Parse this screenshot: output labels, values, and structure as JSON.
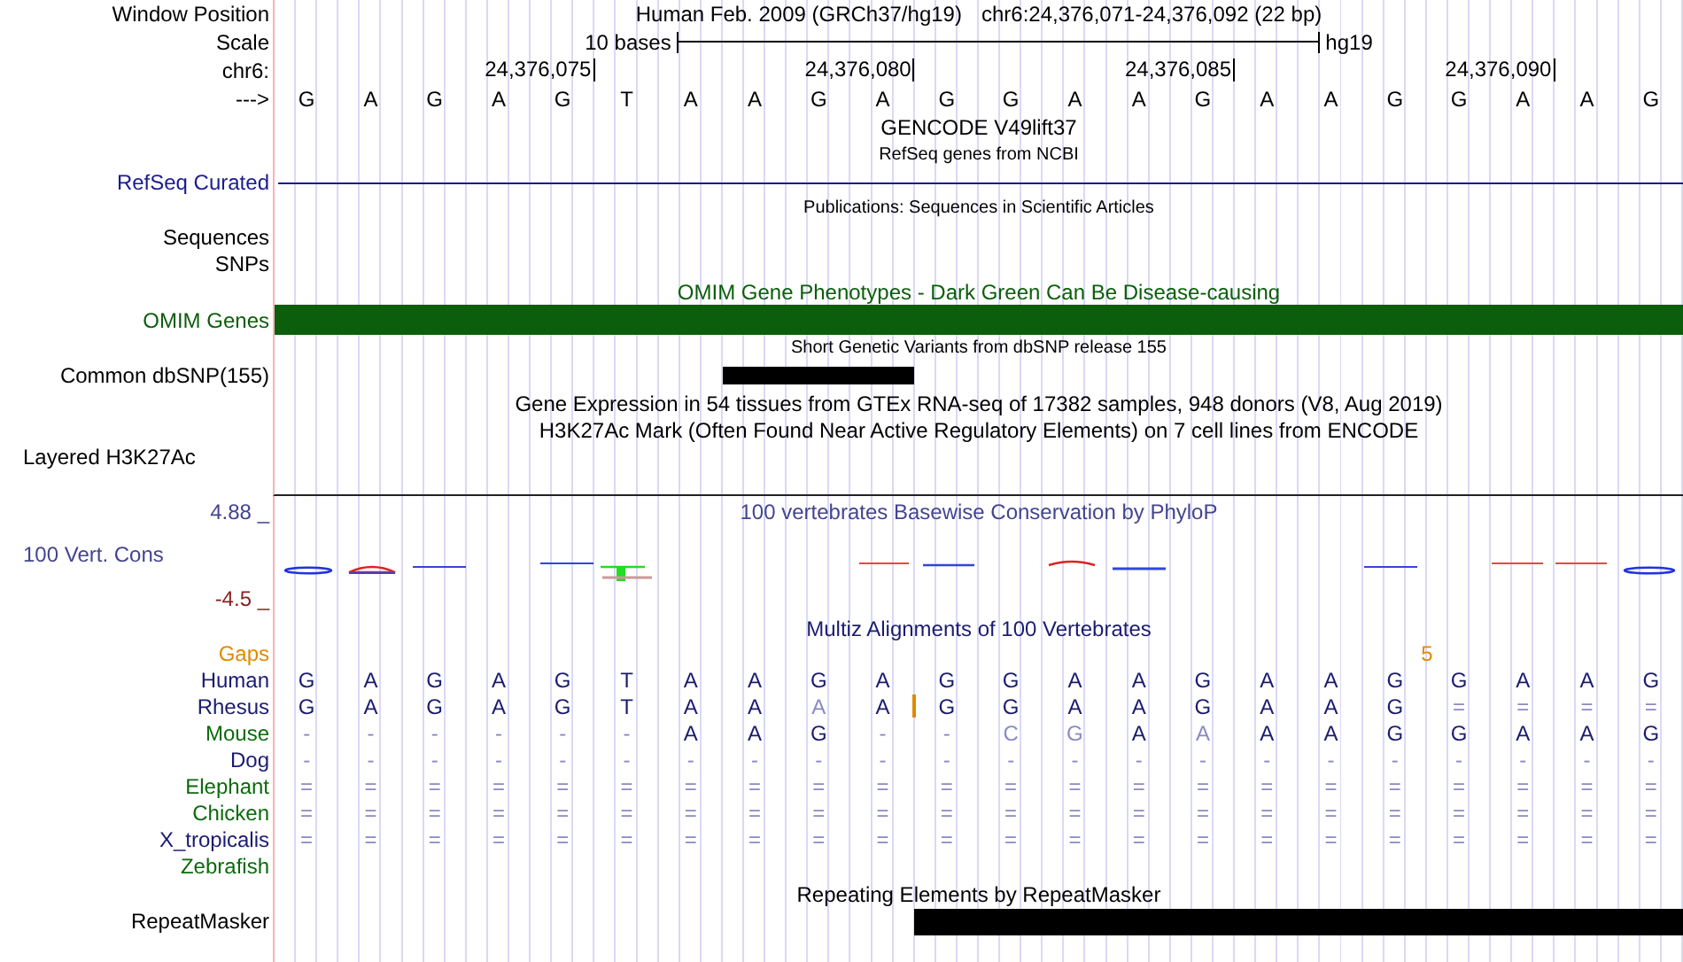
{
  "header": {
    "label": "Window Position",
    "title": "Human Feb. 2009 (GRCh37/hg19)",
    "position": "chr6:24,376,071-24,376,092 (22 bp)"
  },
  "scale": {
    "label": "Scale",
    "left_text": "10 bases",
    "right_text": "hg19"
  },
  "ruler": {
    "label": "chr6:",
    "ticks": [
      "24,376,075",
      "24,376,080",
      "24,376,085",
      "24,376,090"
    ]
  },
  "sequence": {
    "label": "--->",
    "bases": [
      "G",
      "A",
      "G",
      "A",
      "G",
      "T",
      "A",
      "A",
      "G",
      "A",
      "G",
      "G",
      "A",
      "A",
      "G",
      "A",
      "A",
      "G",
      "G",
      "A",
      "A",
      "G"
    ]
  },
  "tracks": [
    {
      "kind": "title",
      "title": "GENCODE V49lift37",
      "color": "#000000"
    },
    {
      "kind": "note",
      "title": "RefSeq genes from NCBI"
    },
    {
      "kind": "line",
      "label": "RefSeq Curated",
      "color": "#1b1b8f"
    },
    {
      "kind": "note",
      "title": "Publications: Sequences in Scientific Articles"
    },
    {
      "kind": "label",
      "label": "Sequences",
      "color": "#000000"
    },
    {
      "kind": "label",
      "label": "SNPs",
      "color": "#000000"
    },
    {
      "kind": "title",
      "title": "OMIM Gene Phenotypes - Dark Green Can Be Disease-causing",
      "color": "#0b5e0b"
    },
    {
      "kind": "bar",
      "label": "OMIM Genes",
      "color": "#0b5e0b"
    },
    {
      "kind": "note",
      "title": "Short Genetic Variants from dbSNP release 155"
    },
    {
      "kind": "bar",
      "label": "Common dbSNP(155)",
      "color": "#000000"
    },
    {
      "kind": "title",
      "title": "Gene Expression in 54 tissues from GTEx RNA-seq of 17382 samples, 948 donors (V8, Aug 2019)",
      "color": "#000000"
    },
    {
      "kind": "title",
      "title": "H3K27Ac Mark (Often Found Near Active Regulatory Elements) on 7 cell lines from ENCODE",
      "color": "#000000"
    },
    {
      "kind": "composite",
      "label": "Layered H3K27Ac",
      "color": "#000000"
    },
    {
      "kind": "rule"
    }
  ],
  "conservation": {
    "max": "4.88 _",
    "title": "100 vertebrates Basewise Conservation by PhyloP",
    "label": "100 Vert. Cons",
    "min": "-4.5 _"
  },
  "multiz": {
    "title": "Multiz Alignments of 100 Vertebrates",
    "gaps": {
      "label": "Gaps",
      "marks": [
        {
          "text": "5"
        }
      ]
    },
    "species": [
      {
        "name": "Human",
        "color": "#1b1b70",
        "bases": [
          {
            "b": "G",
            "faded": false
          },
          {
            "b": "A",
            "faded": false
          },
          {
            "b": "G",
            "faded": false
          },
          {
            "b": "A",
            "faded": false
          },
          {
            "b": "G",
            "faded": false
          },
          {
            "b": "T",
            "faded": false
          },
          {
            "b": "A",
            "faded": false
          },
          {
            "b": "A",
            "faded": false
          },
          {
            "b": "G",
            "faded": false
          },
          {
            "b": "A",
            "faded": false
          },
          {
            "b": "G",
            "faded": false
          },
          {
            "b": "G",
            "faded": false
          },
          {
            "b": "A",
            "faded": false
          },
          {
            "b": "A",
            "faded": false
          },
          {
            "b": "G",
            "faded": false
          },
          {
            "b": "A",
            "faded": false
          },
          {
            "b": "A",
            "faded": false
          },
          {
            "b": "G",
            "faded": false
          },
          {
            "b": "G",
            "faded": false
          },
          {
            "b": "A",
            "faded": false
          },
          {
            "b": "A",
            "faded": false
          },
          {
            "b": "G",
            "faded": false
          }
        ]
      },
      {
        "name": "Rhesus",
        "color": "#1b1b70",
        "bases": [
          {
            "b": "G",
            "faded": false
          },
          {
            "b": "A",
            "faded": false
          },
          {
            "b": "G",
            "faded": false
          },
          {
            "b": "A",
            "faded": false
          },
          {
            "b": "G",
            "faded": false
          },
          {
            "b": "T",
            "faded": false
          },
          {
            "b": "A",
            "faded": false
          },
          {
            "b": "A",
            "faded": false
          },
          {
            "b": "A",
            "faded": true
          },
          {
            "b": "A",
            "faded": false
          },
          {
            "b": "G",
            "faded": false
          },
          {
            "b": "G",
            "faded": false
          },
          {
            "b": "A",
            "faded": false
          },
          {
            "b": "A",
            "faded": false
          },
          {
            "b": "G",
            "faded": false
          },
          {
            "b": "A",
            "faded": false
          },
          {
            "b": "A",
            "faded": false
          },
          {
            "b": "G",
            "faded": false
          },
          {
            "b": "=",
            "faded": true
          },
          {
            "b": "=",
            "faded": true
          },
          {
            "b": "=",
            "faded": true
          },
          {
            "b": "=",
            "faded": true
          }
        ]
      },
      {
        "name": "Mouse",
        "color": "#0b6b0b",
        "bases": [
          {
            "b": "-",
            "faded": true
          },
          {
            "b": "-",
            "faded": true
          },
          {
            "b": "-",
            "faded": true
          },
          {
            "b": "-",
            "faded": true
          },
          {
            "b": "-",
            "faded": true
          },
          {
            "b": "-",
            "faded": true
          },
          {
            "b": "A",
            "faded": false
          },
          {
            "b": "A",
            "faded": false
          },
          {
            "b": "G",
            "faded": false
          },
          {
            "b": "-",
            "faded": true
          },
          {
            "b": "-",
            "faded": true
          },
          {
            "b": "C",
            "faded": true
          },
          {
            "b": "G",
            "faded": true
          },
          {
            "b": "A",
            "faded": false
          },
          {
            "b": "A",
            "faded": true
          },
          {
            "b": "A",
            "faded": false
          },
          {
            "b": "A",
            "faded": false
          },
          {
            "b": "G",
            "faded": false
          },
          {
            "b": "G",
            "faded": false
          },
          {
            "b": "A",
            "faded": false
          },
          {
            "b": "A",
            "faded": false
          },
          {
            "b": "G",
            "faded": false
          }
        ]
      },
      {
        "name": "Dog",
        "color": "#1b1b70",
        "bases": [
          {
            "b": "-",
            "faded": true
          },
          {
            "b": "-",
            "faded": true
          },
          {
            "b": "-",
            "faded": true
          },
          {
            "b": "-",
            "faded": true
          },
          {
            "b": "-",
            "faded": true
          },
          {
            "b": "-",
            "faded": true
          },
          {
            "b": "-",
            "faded": true
          },
          {
            "b": "-",
            "faded": true
          },
          {
            "b": "-",
            "faded": true
          },
          {
            "b": "-",
            "faded": true
          },
          {
            "b": "-",
            "faded": true
          },
          {
            "b": "-",
            "faded": true
          },
          {
            "b": "-",
            "faded": true
          },
          {
            "b": "-",
            "faded": true
          },
          {
            "b": "-",
            "faded": true
          },
          {
            "b": "-",
            "faded": true
          },
          {
            "b": "-",
            "faded": true
          },
          {
            "b": "-",
            "faded": true
          },
          {
            "b": "-",
            "faded": true
          },
          {
            "b": "-",
            "faded": true
          },
          {
            "b": "-",
            "faded": true
          },
          {
            "b": "-",
            "faded": true
          }
        ]
      },
      {
        "name": "Elephant",
        "color": "#0b6b0b",
        "bases": [
          {
            "b": "=",
            "faded": true
          },
          {
            "b": "=",
            "faded": true
          },
          {
            "b": "=",
            "faded": true
          },
          {
            "b": "=",
            "faded": true
          },
          {
            "b": "=",
            "faded": true
          },
          {
            "b": "=",
            "faded": true
          },
          {
            "b": "=",
            "faded": true
          },
          {
            "b": "=",
            "faded": true
          },
          {
            "b": "=",
            "faded": true
          },
          {
            "b": "=",
            "faded": true
          },
          {
            "b": "=",
            "faded": true
          },
          {
            "b": "=",
            "faded": true
          },
          {
            "b": "=",
            "faded": true
          },
          {
            "b": "=",
            "faded": true
          },
          {
            "b": "=",
            "faded": true
          },
          {
            "b": "=",
            "faded": true
          },
          {
            "b": "=",
            "faded": true
          },
          {
            "b": "=",
            "faded": true
          },
          {
            "b": "=",
            "faded": true
          },
          {
            "b": "=",
            "faded": true
          },
          {
            "b": "=",
            "faded": true
          },
          {
            "b": "=",
            "faded": true
          }
        ]
      },
      {
        "name": "Chicken",
        "color": "#0b6b0b",
        "bases": [
          {
            "b": "=",
            "faded": true
          },
          {
            "b": "=",
            "faded": true
          },
          {
            "b": "=",
            "faded": true
          },
          {
            "b": "=",
            "faded": true
          },
          {
            "b": "=",
            "faded": true
          },
          {
            "b": "=",
            "faded": true
          },
          {
            "b": "=",
            "faded": true
          },
          {
            "b": "=",
            "faded": true
          },
          {
            "b": "=",
            "faded": true
          },
          {
            "b": "=",
            "faded": true
          },
          {
            "b": "=",
            "faded": true
          },
          {
            "b": "=",
            "faded": true
          },
          {
            "b": "=",
            "faded": true
          },
          {
            "b": "=",
            "faded": true
          },
          {
            "b": "=",
            "faded": true
          },
          {
            "b": "=",
            "faded": true
          },
          {
            "b": "=",
            "faded": true
          },
          {
            "b": "=",
            "faded": true
          },
          {
            "b": "=",
            "faded": true
          },
          {
            "b": "=",
            "faded": true
          },
          {
            "b": "=",
            "faded": true
          },
          {
            "b": "=",
            "faded": true
          }
        ]
      },
      {
        "name": "X_tropicalis",
        "color": "#1b1b70",
        "bases": [
          {
            "b": "=",
            "faded": true
          },
          {
            "b": "=",
            "faded": true
          },
          {
            "b": "=",
            "faded": true
          },
          {
            "b": "=",
            "faded": true
          },
          {
            "b": "=",
            "faded": true
          },
          {
            "b": "=",
            "faded": true
          },
          {
            "b": "=",
            "faded": true
          },
          {
            "b": "=",
            "faded": true
          },
          {
            "b": "=",
            "faded": true
          },
          {
            "b": "=",
            "faded": true
          },
          {
            "b": "=",
            "faded": true
          },
          {
            "b": "=",
            "faded": true
          },
          {
            "b": "=",
            "faded": true
          },
          {
            "b": "=",
            "faded": true
          },
          {
            "b": "=",
            "faded": true
          },
          {
            "b": "=",
            "faded": true
          },
          {
            "b": "=",
            "faded": true
          },
          {
            "b": "=",
            "faded": true
          },
          {
            "b": "=",
            "faded": true
          },
          {
            "b": "=",
            "faded": true
          },
          {
            "b": "=",
            "faded": true
          },
          {
            "b": "=",
            "faded": true
          }
        ]
      },
      {
        "name": "Zebrafish",
        "color": "#0b6b0b"
      }
    ]
  },
  "repeatmasker": {
    "title": "Repeating Elements by RepeatMasker",
    "label": "RepeatMasker"
  }
}
